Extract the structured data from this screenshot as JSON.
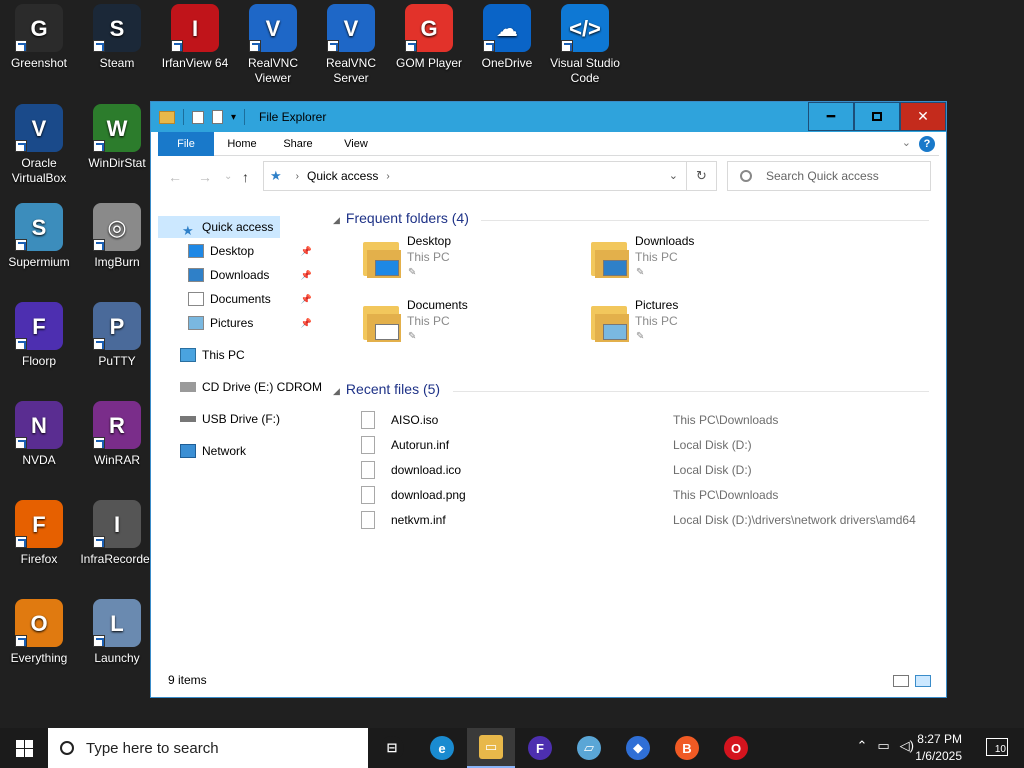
{
  "desktop": {
    "icons": [
      {
        "label": "Greenshot",
        "color": "#2b2b2b",
        "glyph": "G"
      },
      {
        "label": "Steam",
        "color": "#1b2838",
        "glyph": "S"
      },
      {
        "label": "IrfanView 64",
        "color": "#c0141a",
        "glyph": "I"
      },
      {
        "label": "RealVNC Viewer",
        "color": "#1e67c7",
        "glyph": "V"
      },
      {
        "label": "RealVNC Server",
        "color": "#1e67c7",
        "glyph": "V"
      },
      {
        "label": "GOM Player",
        "color": "#e2322a",
        "glyph": "G"
      },
      {
        "label": "OneDrive",
        "color": "#0a64c7",
        "glyph": "☁"
      },
      {
        "label": "Visual Studio Code",
        "color": "#0e78d4",
        "glyph": "&lt;/&gt;"
      },
      {
        "label": "Oracle VirtualBox",
        "color": "#1a4a8a",
        "glyph": "V"
      },
      {
        "label": "WinDirStat",
        "color": "#2c7c2c",
        "glyph": "W"
      },
      {
        "label": "Supermium",
        "color": "#3c8dbc",
        "glyph": "S"
      },
      {
        "label": "ImgBurn",
        "color": "#8a8a8a",
        "glyph": "◎"
      },
      {
        "label": "Floorp",
        "color": "#4d2fb0",
        "glyph": "F"
      },
      {
        "label": "PuTTY",
        "color": "#4a6a9a",
        "glyph": "P"
      },
      {
        "label": "NVDA",
        "color": "#5a2d91",
        "glyph": "N"
      },
      {
        "label": "WinRAR",
        "color": "#7a2d8a",
        "glyph": "R"
      },
      {
        "label": "Firefox",
        "color": "#e66000",
        "glyph": "F"
      },
      {
        "label": "InfraRecorder",
        "color": "#555555",
        "glyph": "I"
      },
      {
        "label": "Everything",
        "color": "#e07a10",
        "glyph": "O"
      },
      {
        "label": "Launchy",
        "color": "#6a8ab0",
        "glyph": "L"
      }
    ]
  },
  "explorer": {
    "title": "File Explorer",
    "tabs": [
      "File",
      "Home",
      "Share",
      "View"
    ],
    "help": "?",
    "address": {
      "location": "Quick access"
    },
    "search": {
      "placeholder": "Search Quick access"
    },
    "nav": {
      "quick_access": "Quick access",
      "pinned": [
        "Desktop",
        "Downloads",
        "Documents",
        "Pictures"
      ],
      "this_pc": "This PC",
      "cd_drive": "CD Drive (E:) CDROM",
      "usb_drive": "USB Drive (F:)",
      "network": "Network"
    },
    "frequent": {
      "title": "Frequent folders (4)",
      "folders": [
        {
          "name": "Desktop",
          "location": "This PC",
          "badge": "#1e88e5"
        },
        {
          "name": "Downloads",
          "location": "This PC",
          "badge": "#2f80c8"
        },
        {
          "name": "Documents",
          "location": "This PC",
          "badge": "#ffffff"
        },
        {
          "name": "Pictures",
          "location": "This PC",
          "badge": "#7ab8e0"
        }
      ]
    },
    "recent": {
      "title": "Recent files (5)",
      "files": [
        {
          "name": "AISO.iso",
          "path": "This PC\\Downloads"
        },
        {
          "name": "Autorun.inf",
          "path": "Local Disk (D:)"
        },
        {
          "name": "download.ico",
          "path": "Local Disk (D:)"
        },
        {
          "name": "download.png",
          "path": "This PC\\Downloads"
        },
        {
          "name": "netkvm.inf",
          "path": "Local Disk (D:)\\drivers\\network drivers\\amd64"
        }
      ]
    },
    "status": "9 items"
  },
  "taskbar": {
    "search_placeholder": "Type here to search",
    "time": "8:27 PM",
    "date": "1/6/2025",
    "notification_count": "10",
    "pinned_apps": [
      {
        "name": "task-view",
        "color": "#1b1b1b",
        "glyph": "⊟"
      },
      {
        "name": "edge",
        "color": "#1a8bd0",
        "glyph": "e"
      },
      {
        "name": "file-explorer",
        "color": "#e8b84a",
        "glyph": "▭"
      },
      {
        "name": "floorp",
        "color": "#4d2fb0",
        "glyph": "F"
      },
      {
        "name": "notepad",
        "color": "#5aa6d6",
        "glyph": "▱"
      },
      {
        "name": "app-blue",
        "color": "#2f6fd6",
        "glyph": "◆"
      },
      {
        "name": "brave",
        "color": "#f05a24",
        "glyph": "B"
      },
      {
        "name": "opera",
        "color": "#d4141e",
        "glyph": "O"
      }
    ]
  }
}
